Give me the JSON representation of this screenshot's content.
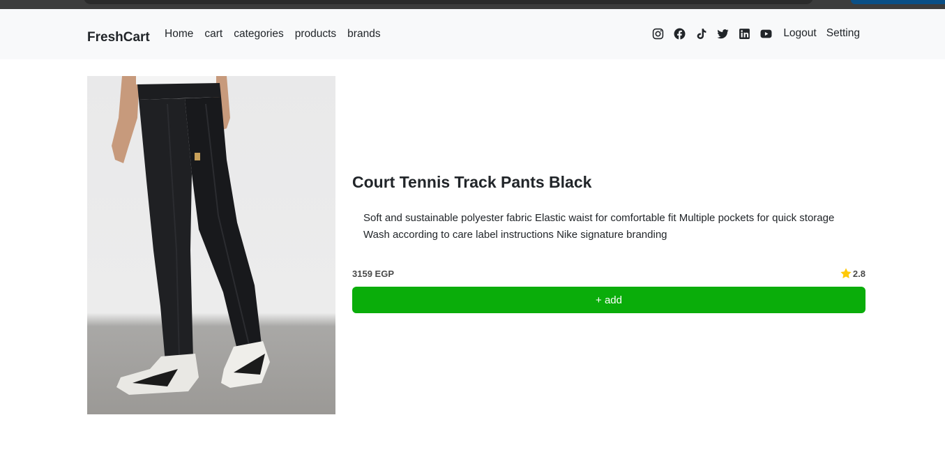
{
  "navbar": {
    "brand": "FreshCart",
    "links": [
      "Home",
      "cart",
      "categories",
      "products",
      "brands"
    ],
    "social_icons": [
      "instagram-icon",
      "facebook-icon",
      "tiktok-icon",
      "twitter-icon",
      "linkedin-icon",
      "youtube-icon"
    ],
    "logout": "Logout",
    "setting": "Setting"
  },
  "product": {
    "title": "Court Tennis Track Pants Black",
    "description": "Soft and sustainable polyester fabric Elastic waist for comfortable fit Multiple pockets for quick storage Wash according to care label instructions Nike signature branding",
    "price": "3159 EGP",
    "rating": "2.8",
    "add_label": "+ add",
    "image": "track-pants-photo"
  },
  "colors": {
    "accent": "#0aad0a",
    "star": "#ffc908",
    "navbar_bg": "#f8f9fa"
  }
}
